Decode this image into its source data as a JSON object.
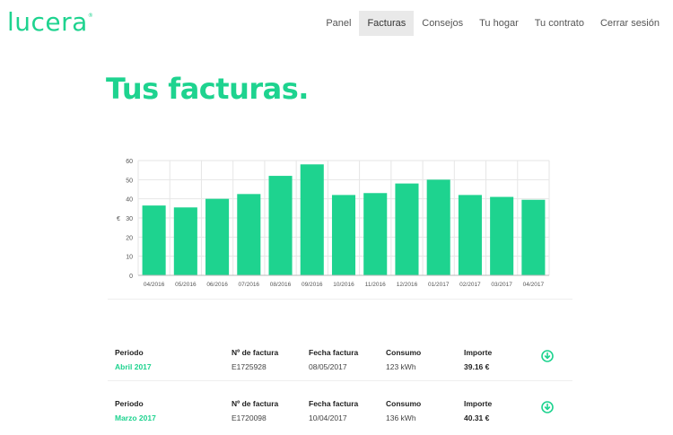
{
  "logo": "lucera",
  "nav": [
    {
      "label": "Panel",
      "active": false
    },
    {
      "label": "Facturas",
      "active": true
    },
    {
      "label": "Consejos",
      "active": false
    },
    {
      "label": "Tu hogar",
      "active": false
    },
    {
      "label": "Tu contrato",
      "active": false
    },
    {
      "label": "Cerrar sesión",
      "active": false
    }
  ],
  "page_title": "Tus facturas.",
  "chart_data": {
    "type": "bar",
    "categories": [
      "04/2016",
      "05/2016",
      "06/2016",
      "07/2016",
      "08/2016",
      "09/2016",
      "10/2016",
      "11/2016",
      "12/2016",
      "01/2017",
      "02/2017",
      "03/2017",
      "04/2017"
    ],
    "values": [
      36.5,
      35.5,
      40,
      42.5,
      52,
      58,
      42,
      43,
      48,
      50,
      42,
      41,
      39.5
    ],
    "ylabel": "€",
    "ylim": [
      0,
      60
    ],
    "yticks": [
      0,
      10,
      20,
      30,
      40,
      50,
      60
    ],
    "grid": true,
    "color": "#1ed38f"
  },
  "invoice_labels": {
    "periodo": "Periodo",
    "numero": "Nº de factura",
    "fecha": "Fecha factura",
    "consumo": "Consumo",
    "importe": "Importe"
  },
  "invoices": [
    {
      "periodo": "Abril 2017",
      "numero": "E1725928",
      "fecha": "08/05/2017",
      "consumo": "123 kWh",
      "importe": "39.16 €"
    },
    {
      "periodo": "Marzo 2017",
      "numero": "E1720098",
      "fecha": "10/04/2017",
      "consumo": "136 kWh",
      "importe": "40.31 €"
    }
  ]
}
